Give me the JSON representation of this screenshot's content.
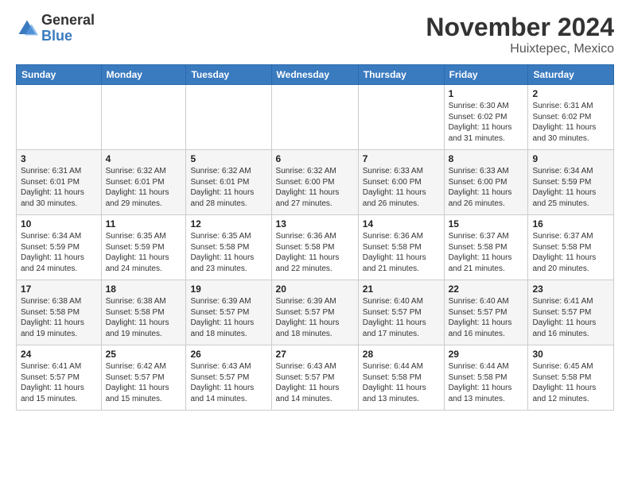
{
  "logo": {
    "general": "General",
    "blue": "Blue"
  },
  "header": {
    "title": "November 2024",
    "subtitle": "Huixtepec, Mexico"
  },
  "weekdays": [
    "Sunday",
    "Monday",
    "Tuesday",
    "Wednesday",
    "Thursday",
    "Friday",
    "Saturday"
  ],
  "weeks": [
    [
      {
        "day": "",
        "info": ""
      },
      {
        "day": "",
        "info": ""
      },
      {
        "day": "",
        "info": ""
      },
      {
        "day": "",
        "info": ""
      },
      {
        "day": "",
        "info": ""
      },
      {
        "day": "1",
        "info": "Sunrise: 6:30 AM\nSunset: 6:02 PM\nDaylight: 11 hours and 31 minutes."
      },
      {
        "day": "2",
        "info": "Sunrise: 6:31 AM\nSunset: 6:02 PM\nDaylight: 11 hours and 30 minutes."
      }
    ],
    [
      {
        "day": "3",
        "info": "Sunrise: 6:31 AM\nSunset: 6:01 PM\nDaylight: 11 hours and 30 minutes."
      },
      {
        "day": "4",
        "info": "Sunrise: 6:32 AM\nSunset: 6:01 PM\nDaylight: 11 hours and 29 minutes."
      },
      {
        "day": "5",
        "info": "Sunrise: 6:32 AM\nSunset: 6:01 PM\nDaylight: 11 hours and 28 minutes."
      },
      {
        "day": "6",
        "info": "Sunrise: 6:32 AM\nSunset: 6:00 PM\nDaylight: 11 hours and 27 minutes."
      },
      {
        "day": "7",
        "info": "Sunrise: 6:33 AM\nSunset: 6:00 PM\nDaylight: 11 hours and 26 minutes."
      },
      {
        "day": "8",
        "info": "Sunrise: 6:33 AM\nSunset: 6:00 PM\nDaylight: 11 hours and 26 minutes."
      },
      {
        "day": "9",
        "info": "Sunrise: 6:34 AM\nSunset: 5:59 PM\nDaylight: 11 hours and 25 minutes."
      }
    ],
    [
      {
        "day": "10",
        "info": "Sunrise: 6:34 AM\nSunset: 5:59 PM\nDaylight: 11 hours and 24 minutes."
      },
      {
        "day": "11",
        "info": "Sunrise: 6:35 AM\nSunset: 5:59 PM\nDaylight: 11 hours and 24 minutes."
      },
      {
        "day": "12",
        "info": "Sunrise: 6:35 AM\nSunset: 5:58 PM\nDaylight: 11 hours and 23 minutes."
      },
      {
        "day": "13",
        "info": "Sunrise: 6:36 AM\nSunset: 5:58 PM\nDaylight: 11 hours and 22 minutes."
      },
      {
        "day": "14",
        "info": "Sunrise: 6:36 AM\nSunset: 5:58 PM\nDaylight: 11 hours and 21 minutes."
      },
      {
        "day": "15",
        "info": "Sunrise: 6:37 AM\nSunset: 5:58 PM\nDaylight: 11 hours and 21 minutes."
      },
      {
        "day": "16",
        "info": "Sunrise: 6:37 AM\nSunset: 5:58 PM\nDaylight: 11 hours and 20 minutes."
      }
    ],
    [
      {
        "day": "17",
        "info": "Sunrise: 6:38 AM\nSunset: 5:58 PM\nDaylight: 11 hours and 19 minutes."
      },
      {
        "day": "18",
        "info": "Sunrise: 6:38 AM\nSunset: 5:58 PM\nDaylight: 11 hours and 19 minutes."
      },
      {
        "day": "19",
        "info": "Sunrise: 6:39 AM\nSunset: 5:57 PM\nDaylight: 11 hours and 18 minutes."
      },
      {
        "day": "20",
        "info": "Sunrise: 6:39 AM\nSunset: 5:57 PM\nDaylight: 11 hours and 18 minutes."
      },
      {
        "day": "21",
        "info": "Sunrise: 6:40 AM\nSunset: 5:57 PM\nDaylight: 11 hours and 17 minutes."
      },
      {
        "day": "22",
        "info": "Sunrise: 6:40 AM\nSunset: 5:57 PM\nDaylight: 11 hours and 16 minutes."
      },
      {
        "day": "23",
        "info": "Sunrise: 6:41 AM\nSunset: 5:57 PM\nDaylight: 11 hours and 16 minutes."
      }
    ],
    [
      {
        "day": "24",
        "info": "Sunrise: 6:41 AM\nSunset: 5:57 PM\nDaylight: 11 hours and 15 minutes."
      },
      {
        "day": "25",
        "info": "Sunrise: 6:42 AM\nSunset: 5:57 PM\nDaylight: 11 hours and 15 minutes."
      },
      {
        "day": "26",
        "info": "Sunrise: 6:43 AM\nSunset: 5:57 PM\nDaylight: 11 hours and 14 minutes."
      },
      {
        "day": "27",
        "info": "Sunrise: 6:43 AM\nSunset: 5:57 PM\nDaylight: 11 hours and 14 minutes."
      },
      {
        "day": "28",
        "info": "Sunrise: 6:44 AM\nSunset: 5:58 PM\nDaylight: 11 hours and 13 minutes."
      },
      {
        "day": "29",
        "info": "Sunrise: 6:44 AM\nSunset: 5:58 PM\nDaylight: 11 hours and 13 minutes."
      },
      {
        "day": "30",
        "info": "Sunrise: 6:45 AM\nSunset: 5:58 PM\nDaylight: 11 hours and 12 minutes."
      }
    ]
  ]
}
